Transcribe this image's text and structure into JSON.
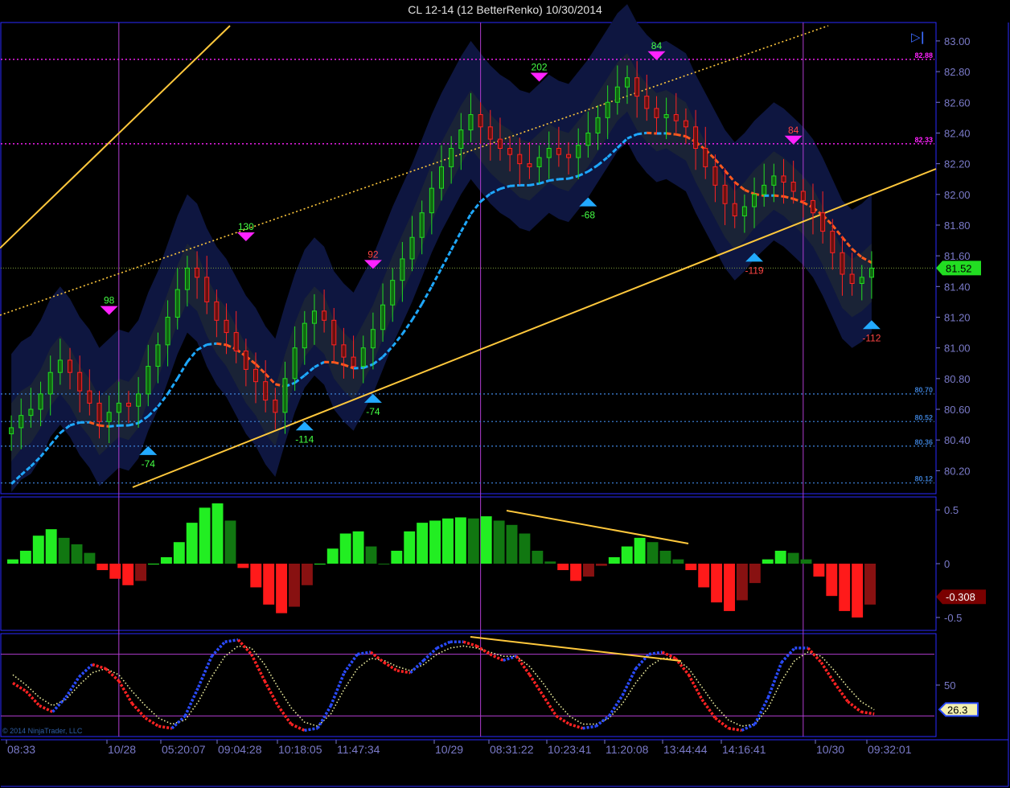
{
  "title": "CL 12-14 (12 BetterRenko)  10/30/2014",
  "copyright": "© 2014 NinjaTrader, LLC",
  "end_button_icon": "skip-to-end-icon",
  "colors": {
    "background": "#000000",
    "border": "#2a2aff",
    "axis_text": "#7a7ac8",
    "session_line": "#b03ccf",
    "up_bar": "#22dd22",
    "down_bar": "#ff2222",
    "band": "#0e1640",
    "band_inner": "#1a2336",
    "trend_line": "#ffc83c",
    "ma_up": "#1ea8ff",
    "ma_down": "#ff5a1e",
    "marker_top": "#ff22ff",
    "marker_bottom": "#22aaff",
    "price_line": "#7ea03c"
  },
  "chart_data": [
    {
      "type": "candlestick",
      "panel": "price",
      "title": "CL 12-14 (12 BetterRenko)  10/30/2014",
      "ylim": [
        80.05,
        83.12
      ],
      "yticks": [
        "83.00",
        "82.80",
        "82.60",
        "82.40",
        "82.20",
        "82.00",
        "81.80",
        "81.60",
        "81.40",
        "81.20",
        "81.00",
        "80.80",
        "80.60",
        "80.40",
        "80.20"
      ],
      "last_price": "81.52",
      "close_series": [
        80.48,
        80.56,
        80.6,
        80.7,
        80.84,
        80.92,
        80.84,
        80.72,
        80.64,
        80.52,
        80.58,
        80.64,
        80.62,
        80.7,
        80.88,
        81.02,
        81.2,
        81.38,
        81.52,
        81.46,
        81.3,
        81.18,
        81.1,
        80.98,
        80.86,
        80.78,
        80.66,
        80.58,
        80.8,
        81.0,
        81.16,
        81.24,
        81.18,
        81.02,
        80.94,
        80.88,
        81.0,
        81.12,
        81.28,
        81.44,
        81.58,
        81.72,
        81.88,
        82.04,
        82.18,
        82.3,
        82.42,
        82.52,
        82.44,
        82.36,
        82.3,
        82.26,
        82.2,
        82.18,
        82.24,
        82.3,
        82.26,
        82.24,
        82.32,
        82.4,
        82.5,
        82.6,
        82.7,
        82.76,
        82.64,
        82.56,
        82.5,
        82.52,
        82.48,
        82.44,
        82.3,
        82.18,
        82.06,
        81.94,
        81.86,
        81.92,
        82.0,
        82.06,
        82.12,
        82.08,
        82.02,
        81.96,
        81.88,
        81.76,
        81.62,
        81.48,
        81.42,
        81.46,
        81.52
      ],
      "session_labels": [
        "10/28",
        "10/29",
        "10/30"
      ],
      "x_tick_labels": [
        "08:33",
        "10/28",
        "05:20:07",
        "09:04:28",
        "10:18:05",
        "11:47:34",
        "10/29",
        "08:31:22",
        "10:23:41",
        "11:20:08",
        "13:44:44",
        "14:16:41",
        "10/30",
        "09:32:01"
      ],
      "swing_highs": [
        {
          "label": "98",
          "price": 81.22
        },
        {
          "label": "130",
          "price": 81.7
        },
        {
          "label": "92",
          "price": 81.52
        },
        {
          "label": "202",
          "price": 82.74
        },
        {
          "label": "84",
          "price": 82.88
        },
        {
          "label": "84",
          "price": 82.33
        }
      ],
      "swing_lows": [
        {
          "label": "-74",
          "price": 80.36
        },
        {
          "label": "-114",
          "price": 80.52
        },
        {
          "label": "-74",
          "price": 80.7
        },
        {
          "label": "-68",
          "price": 81.98
        },
        {
          "label": "-119",
          "price": 81.62
        },
        {
          "label": "-112",
          "price": 81.18
        }
      ],
      "level_labels": [
        {
          "label": "82.88",
          "price": 82.88
        },
        {
          "label": "82.33",
          "price": 82.33
        },
        {
          "label": "80.70",
          "price": 80.7
        },
        {
          "label": "80.52",
          "price": 80.52
        },
        {
          "label": "80.36",
          "price": 80.36
        },
        {
          "label": "80.12",
          "price": 80.12
        }
      ]
    },
    {
      "type": "bar",
      "panel": "histogram",
      "ylim": [
        -0.62,
        0.62
      ],
      "yticks": [
        "0.5",
        "0",
        "-0.5"
      ],
      "last_value": "-0.308",
      "values": [
        0.04,
        0.12,
        0.26,
        0.32,
        0.24,
        0.18,
        0.1,
        -0.06,
        -0.14,
        -0.2,
        -0.16,
        0.0,
        0.06,
        0.2,
        0.38,
        0.52,
        0.56,
        0.4,
        -0.04,
        -0.22,
        -0.38,
        -0.46,
        -0.4,
        -0.2,
        0.0,
        0.14,
        0.28,
        0.3,
        0.16,
        0.0,
        0.12,
        0.3,
        0.38,
        0.4,
        0.42,
        0.43,
        0.42,
        0.44,
        0.4,
        0.36,
        0.28,
        0.12,
        0.02,
        -0.06,
        -0.16,
        -0.12,
        -0.02,
        0.06,
        0.16,
        0.24,
        0.2,
        0.12,
        0.04,
        -0.06,
        -0.22,
        -0.36,
        -0.44,
        -0.34,
        -0.18,
        0.04,
        0.12,
        0.1,
        0.04,
        -0.12,
        -0.3,
        -0.44,
        -0.5,
        -0.38
      ]
    },
    {
      "type": "line",
      "panel": "oscillator",
      "ylim": [
        0,
        100
      ],
      "yticks": [
        "50"
      ],
      "last_value": "26.3",
      "series": [
        {
          "values": [
            52,
            44,
            30,
            24,
            38,
            58,
            70,
            66,
            54,
            32,
            18,
            10,
            8,
            20,
            48,
            78,
            92,
            94,
            80,
            54,
            30,
            12,
            6,
            8,
            30,
            62,
            80,
            82,
            72,
            64,
            62,
            74,
            86,
            92,
            92,
            88,
            80,
            74,
            78,
            60,
            40,
            20,
            12,
            8,
            10,
            20,
            40,
            66,
            80,
            82,
            76,
            60,
            36,
            18,
            8,
            6,
            12,
            38,
            72,
            86,
            86,
            72,
            52,
            34,
            24,
            22
          ]
        },
        {
          "values": [
            60,
            50,
            38,
            30,
            36,
            50,
            62,
            66,
            60,
            44,
            30,
            18,
            12,
            16,
            34,
            58,
            78,
            88,
            86,
            70,
            48,
            28,
            14,
            10,
            22,
            46,
            66,
            76,
            74,
            68,
            64,
            70,
            80,
            86,
            88,
            86,
            82,
            78,
            78,
            68,
            52,
            34,
            20,
            12,
            12,
            18,
            32,
            52,
            68,
            76,
            76,
            66,
            48,
            30,
            16,
            10,
            12,
            28,
            54,
            74,
            82,
            78,
            64,
            48,
            34,
            26
          ]
        }
      ]
    }
  ]
}
